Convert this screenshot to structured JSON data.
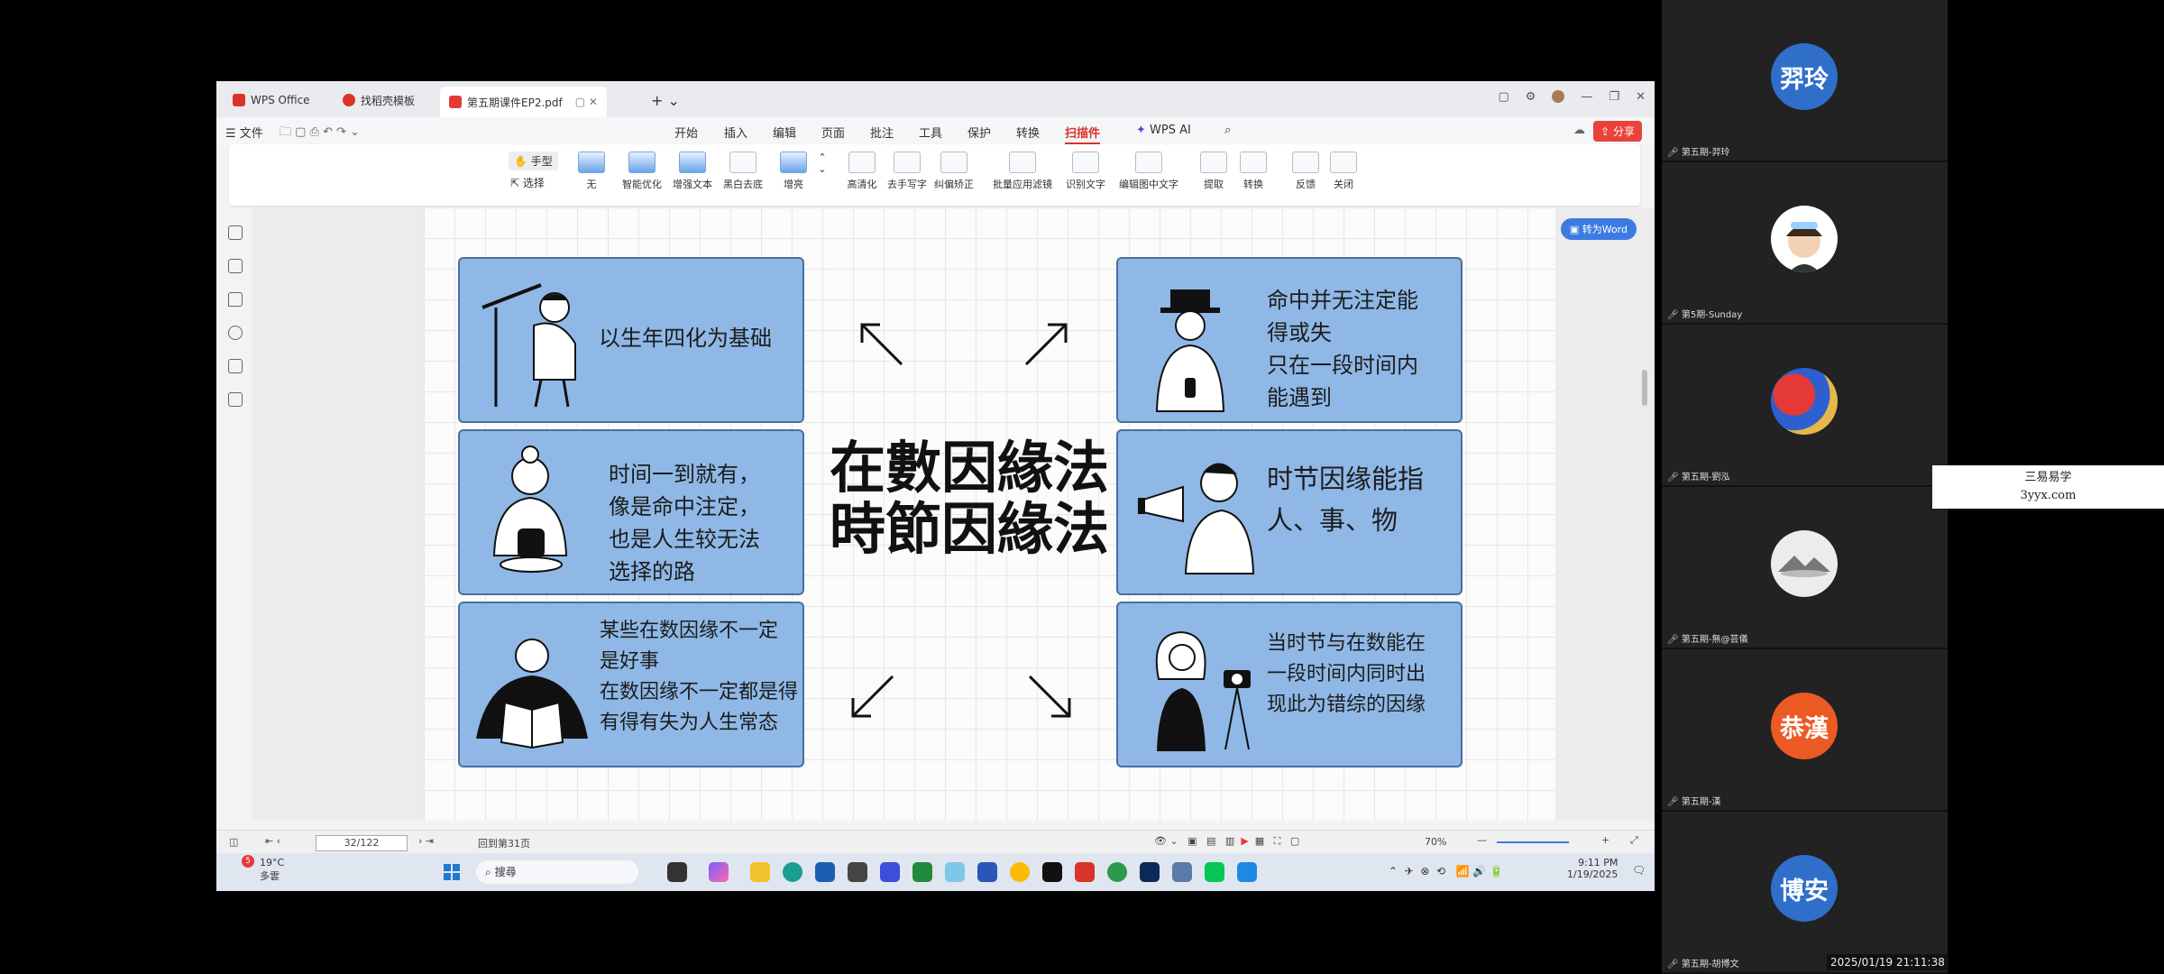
{
  "tabs": [
    {
      "label": "WPS Office",
      "color": "#d9332a"
    },
    {
      "label": "找稻壳模板",
      "color": "#d9332a"
    },
    {
      "label": "第五期课件EP2.pdf",
      "color": "#e53935"
    }
  ],
  "menu": {
    "file": "文件",
    "items": [
      "开始",
      "插入",
      "编辑",
      "页面",
      "批注",
      "工具",
      "保护",
      "转换",
      "扫描件"
    ],
    "active": "扫描件",
    "wps_ai": "WPS AI",
    "share": "分享"
  },
  "ribbon": {
    "hand": "手型",
    "select": "选择",
    "tools": [
      "无",
      "智能优化",
      "增强文本",
      "黑白去底",
      "增亮",
      "高清化",
      "去手写字",
      "纠偏矫正",
      "批量应用滤镜",
      "识别文字",
      "编辑图中文字",
      "提取",
      "转换",
      "反馈",
      "关闭"
    ]
  },
  "to_word": "转为Word",
  "slide": {
    "title_line1": "在數因緣法",
    "title_line2": "時節因緣法",
    "cards": {
      "top_left": [
        "以生年四化为基础"
      ],
      "top_right": [
        "命中并无注定能",
        "得或失",
        "只在一段时间内",
        "能遇到"
      ],
      "mid_left": [
        "时间一到就有，",
        "像是命中注定，",
        "也是人生较无法",
        "选择的路"
      ],
      "mid_right": [
        "时节因缘能指",
        "人、事、物"
      ],
      "bot_left": [
        "某些在数因缘不一定",
        "是好事",
        "在数因缘不一定都是得",
        "有得有失为人生常态"
      ],
      "bot_right": [
        "当时节与在数能在",
        "一段时间内同时出",
        "现此为错综的因缘"
      ]
    }
  },
  "status": {
    "page": "32/122",
    "goto": "回到第31页",
    "zoom": "70%"
  },
  "taskbar": {
    "weather_temp": "19°C",
    "weather_desc": "多雲",
    "search": "搜尋",
    "time": "9:11 PM",
    "date": "1/19/2025",
    "badge": "5"
  },
  "participants": [
    {
      "avatar_text": "羿玲",
      "color": "#2f6fca",
      "name": "第五期-羿玲"
    },
    {
      "avatar_text": "",
      "color": "#ffffff",
      "name": "第5期-Sunday"
    },
    {
      "avatar_text": "",
      "color": "#c0392b",
      "name": "第五期-劉泓"
    },
    {
      "avatar_text": "",
      "color": "#e8e8e8",
      "name": "第五期-無@芸儀"
    },
    {
      "avatar_text": "恭漢",
      "color": "#ec5a24",
      "name": "第五期-漢"
    },
    {
      "avatar_text": "博安",
      "color": "#2f6fca",
      "name": "第五期-胡博文"
    }
  ],
  "watermark": {
    "line1": "三易易学",
    "line2": "3yyx.com"
  },
  "timestamp": "2025/01/19 21:11:38"
}
